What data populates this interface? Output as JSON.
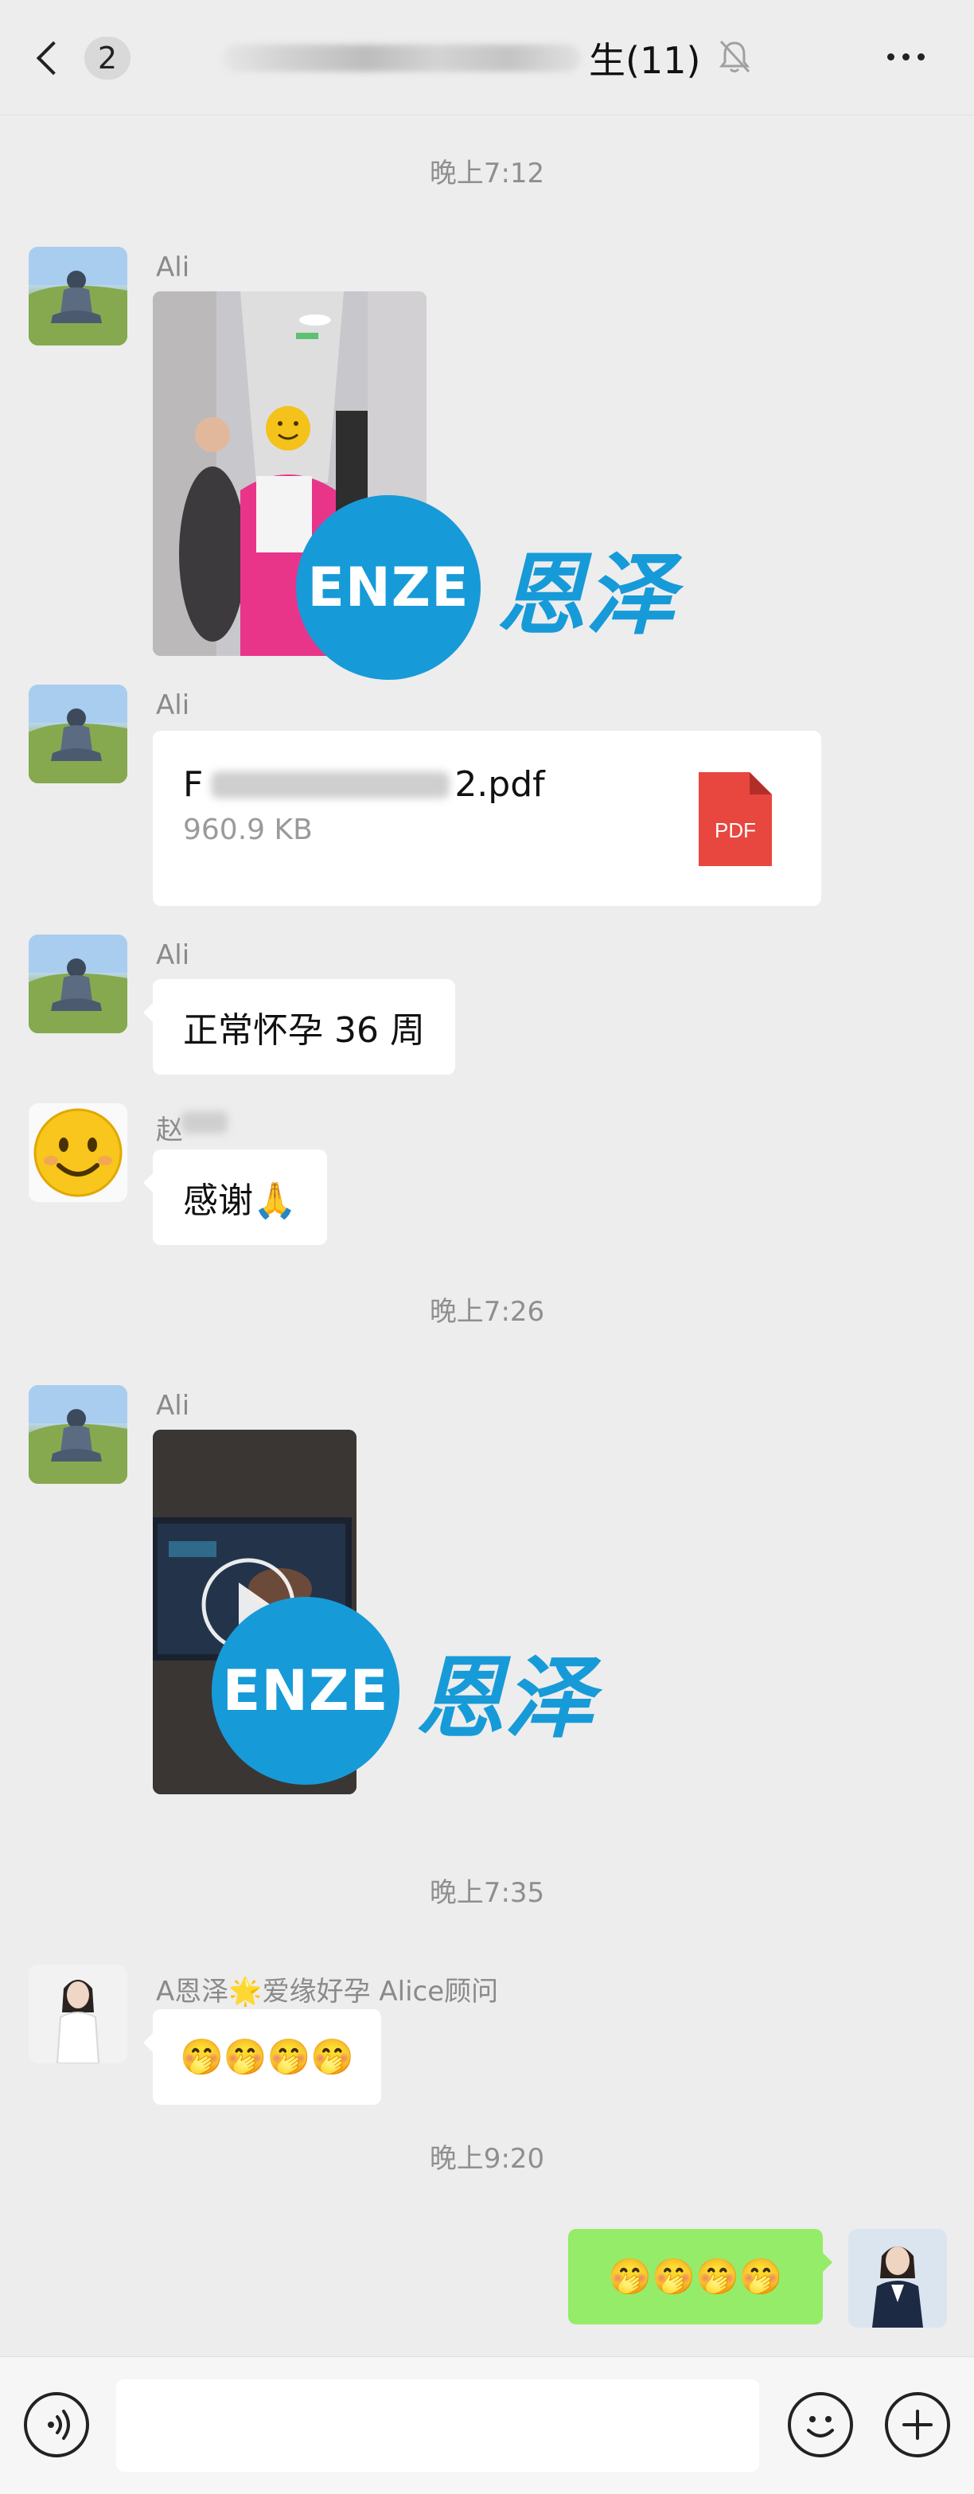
{
  "header": {
    "back_count": "2",
    "title_suffix": "生(11)",
    "icons": {
      "back": "chevron-left-icon",
      "mute": "bell-muted-icon",
      "more": "more-dots-icon"
    }
  },
  "timestamps": [
    "晚上7:12",
    "晚上7:26",
    "晚上7:35",
    "晚上9:20"
  ],
  "messages": {
    "ali_name": "Ali",
    "photo_watermark": {
      "latin": "ENZE",
      "chinese": "恩泽"
    },
    "file": {
      "name_prefix": "F",
      "name_suffix": "2.pdf",
      "size": "960.9 KB",
      "badge": "PDF"
    },
    "text1": "正常怀孕 36 周",
    "smile_sender_prefix": "赵",
    "text2": "感谢🙏",
    "video_watermark": {
      "latin": "ENZE",
      "chinese": "恩泽"
    },
    "alice_name": "A恩泽🌟爱缘好孕 Alice顾问",
    "alice_text": "🤭🤭🤭🤭",
    "self_text": "🤭🤭🤭🤭"
  },
  "input_bar": {
    "placeholder": "",
    "icons": {
      "voice": "voice-icon",
      "emoji": "emoji-icon",
      "plus": "plus-icon"
    }
  }
}
